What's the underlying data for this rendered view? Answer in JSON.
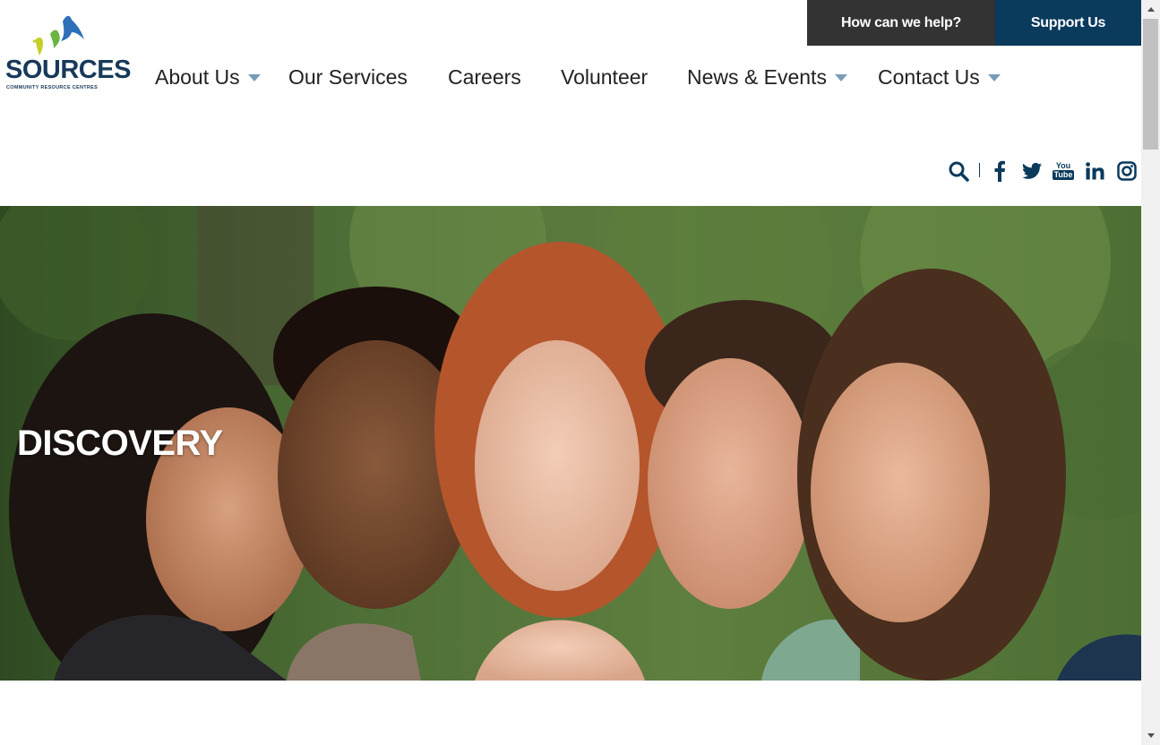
{
  "logo": {
    "name": "SOURCES",
    "tagline": "COMMUNITY RESOURCE CENTRES"
  },
  "topbar": {
    "help_label": "How can we help?",
    "support_label": "Support Us"
  },
  "nav": {
    "items": [
      {
        "label": "About Us",
        "dropdown": true
      },
      {
        "label": "Our Services",
        "dropdown": false
      },
      {
        "label": "Careers",
        "dropdown": false
      },
      {
        "label": "Volunteer",
        "dropdown": false
      },
      {
        "label": "News & Events",
        "dropdown": true
      },
      {
        "label": "Contact Us",
        "dropdown": true
      }
    ]
  },
  "social_icons": [
    "search-icon",
    "facebook-icon",
    "twitter-icon",
    "youtube-icon",
    "linkedin-icon",
    "instagram-icon"
  ],
  "youtube_text": {
    "top": "You",
    "bottom": "Tube"
  },
  "hero": {
    "title": "DISCOVERY"
  },
  "colors": {
    "brand_navy": "#0a3a5c",
    "help_bg": "#333333",
    "caret": "#7a9cb8",
    "hero_green": "#4a6b35"
  }
}
